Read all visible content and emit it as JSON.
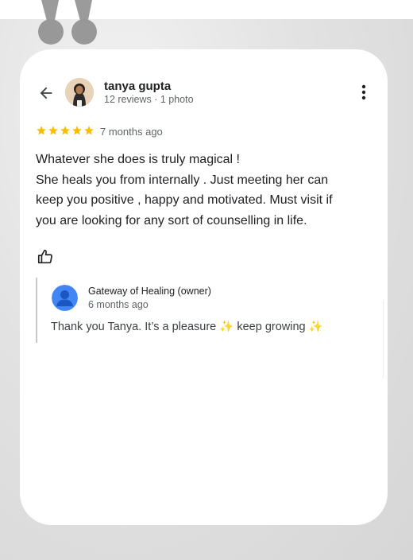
{
  "reviewer": {
    "name": "tanya gupta",
    "meta": "12 reviews · 1 photo"
  },
  "rating": {
    "stars": 5,
    "max": 5,
    "time": "7 months ago"
  },
  "review": {
    "lines": [
      "Whatever she does is truly magical !",
      "She heals you from internally . Just meeting her can",
      "keep you positive , happy and motivated. Must visit if",
      "you are looking for any sort of counselling in life."
    ]
  },
  "reply": {
    "owner_name": "Gateway of Healing (owner)",
    "time": "6 months ago",
    "text_part1": "Thank you Tanya. It’s a pleasure ",
    "sparkle1": "✨",
    "text_part2": " keep growing ",
    "sparkle2": "✨"
  },
  "icons": {
    "back": "arrow-left-icon",
    "menu": "more-vert-icon",
    "like": "thumbs-up-icon",
    "star": "star-icon",
    "quote": "quote-mark-icon",
    "owner": "person-icon"
  },
  "colors": {
    "star": "#fbbc04",
    "owner_avatar": "#4285f4",
    "quote": "#8a8a8a"
  }
}
